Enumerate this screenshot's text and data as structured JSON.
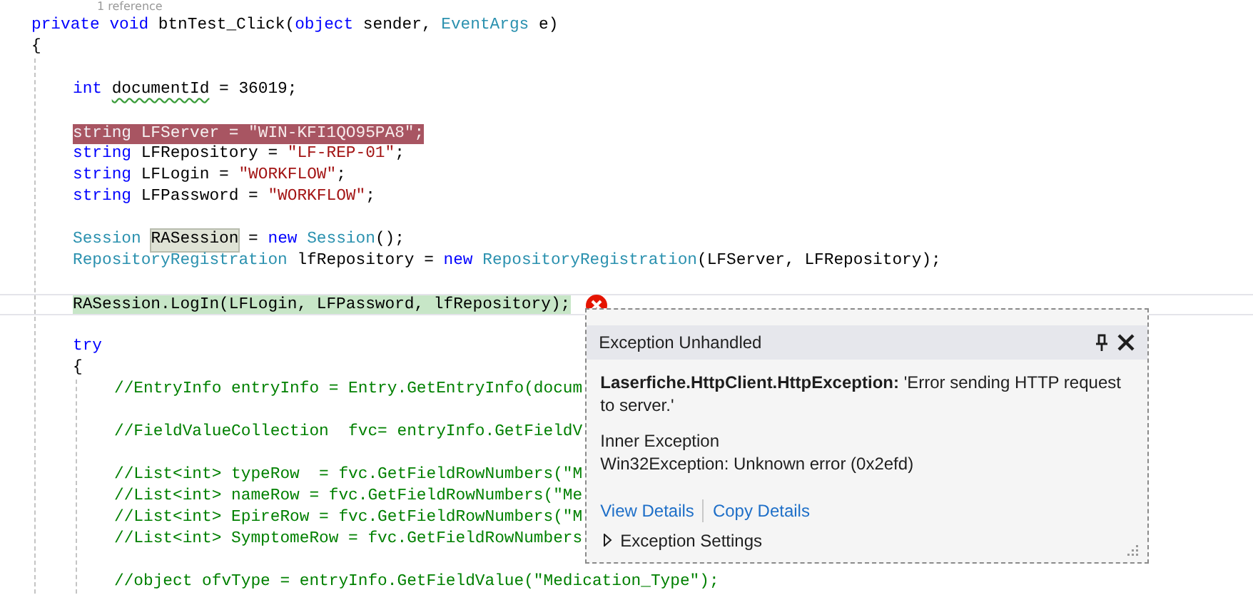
{
  "codelens": "1 reference",
  "lines": [
    {
      "kind": "code",
      "tokens": [
        {
          "kind": "keyword",
          "text": "private "
        },
        {
          "kind": "keyword",
          "text": "void"
        },
        {
          "kind": "plain",
          "text": " btnTest_Click("
        },
        {
          "kind": "keyword",
          "text": "object"
        },
        {
          "kind": "plain",
          "text": " sender, "
        },
        {
          "kind": "type",
          "text": "EventArgs"
        },
        {
          "kind": "plain",
          "text": " e)"
        }
      ]
    },
    {
      "kind": "code",
      "tokens": [
        {
          "kind": "plain",
          "text": "{"
        }
      ]
    },
    {
      "kind": "block",
      "children": [
        {
          "kind": "blank"
        },
        {
          "kind": "code",
          "tokens": [
            {
              "kind": "keyword",
              "text": "int "
            },
            {
              "kind": "plain",
              "text": "documentId",
              "squiggle": true
            },
            {
              "kind": "plain",
              "text": " = 36019;"
            }
          ]
        },
        {
          "kind": "blank"
        },
        {
          "kind": "code",
          "breakpoint": true,
          "tokens": [
            {
              "kind": "keyword",
              "text": "string"
            },
            {
              "kind": "plain",
              "text": " LFServer = "
            },
            {
              "kind": "string",
              "text": "\"WIN-KFI1QO95PA8\""
            },
            {
              "kind": "plain",
              "text": ";"
            }
          ]
        },
        {
          "kind": "code",
          "tokens": [
            {
              "kind": "keyword",
              "text": "string"
            },
            {
              "kind": "plain",
              "text": " LFRepository = "
            },
            {
              "kind": "string",
              "text": "\"LF-REP-01\""
            },
            {
              "kind": "plain",
              "text": ";"
            }
          ]
        },
        {
          "kind": "code",
          "tokens": [
            {
              "kind": "keyword",
              "text": "string"
            },
            {
              "kind": "plain",
              "text": " LFLogin = "
            },
            {
              "kind": "string",
              "text": "\"WORKFLOW\""
            },
            {
              "kind": "plain",
              "text": ";"
            }
          ]
        },
        {
          "kind": "code",
          "tokens": [
            {
              "kind": "keyword",
              "text": "string"
            },
            {
              "kind": "plain",
              "text": " LFPassword = "
            },
            {
              "kind": "string",
              "text": "\"WORKFLOW\""
            },
            {
              "kind": "plain",
              "text": ";"
            }
          ]
        },
        {
          "kind": "blank"
        },
        {
          "kind": "code",
          "tokens": [
            {
              "kind": "type",
              "text": "Session "
            },
            {
              "kind": "plain",
              "text": "RASession",
              "reference": true
            },
            {
              "kind": "plain",
              "text": " = "
            },
            {
              "kind": "keyword",
              "text": "new "
            },
            {
              "kind": "type",
              "text": "Session"
            },
            {
              "kind": "plain",
              "text": "();"
            }
          ]
        },
        {
          "kind": "code",
          "tokens": [
            {
              "kind": "type",
              "text": "RepositoryRegistration"
            },
            {
              "kind": "plain",
              "text": " lfRepository = "
            },
            {
              "kind": "keyword",
              "text": "new "
            },
            {
              "kind": "type",
              "text": "RepositoryRegistration"
            },
            {
              "kind": "plain",
              "text": "(LFServer, LFRepository);"
            }
          ]
        },
        {
          "kind": "blank"
        },
        {
          "kind": "code",
          "current": true,
          "error": true,
          "tokens": [
            {
              "kind": "plain",
              "text": "RASession.LogIn(LFLogin, LFPassword, lfRepository);"
            }
          ]
        },
        {
          "kind": "blank"
        },
        {
          "kind": "code",
          "tokens": [
            {
              "kind": "keyword",
              "text": "try"
            }
          ]
        },
        {
          "kind": "code",
          "tokens": [
            {
              "kind": "plain",
              "text": "{"
            }
          ]
        },
        {
          "kind": "block",
          "children": [
            {
              "kind": "code",
              "tokens": [
                {
                  "kind": "comment",
                  "text": "//EntryInfo entryInfo = Entry.GetEntryInfo(docum"
                }
              ]
            },
            {
              "kind": "blank"
            },
            {
              "kind": "code",
              "tokens": [
                {
                  "kind": "comment",
                  "text": "//FieldValueCollection  fvc= entryInfo.GetFieldV"
                }
              ]
            },
            {
              "kind": "blank"
            },
            {
              "kind": "code",
              "tokens": [
                {
                  "kind": "comment",
                  "text": "//List<int> typeRow  = fvc.GetFieldRowNumbers(\"M"
                }
              ]
            },
            {
              "kind": "code",
              "tokens": [
                {
                  "kind": "comment",
                  "text": "//List<int> nameRow = fvc.GetFieldRowNumbers(\"Me"
                }
              ]
            },
            {
              "kind": "code",
              "tokens": [
                {
                  "kind": "comment",
                  "text": "//List<int> EpireRow = fvc.GetFieldRowNumbers(\"M"
                }
              ]
            },
            {
              "kind": "code",
              "tokens": [
                {
                  "kind": "comment",
                  "text": "//List<int> SymptomeRow = fvc.GetFieldRowNumbers"
                }
              ]
            },
            {
              "kind": "blank"
            },
            {
              "kind": "code",
              "tokens": [
                {
                  "kind": "comment",
                  "text": "//object ofvType = entryInfo.GetFieldValue(\"Medication_Type\");"
                }
              ]
            }
          ]
        }
      ]
    }
  ],
  "exception_popup": {
    "title": "Exception Unhandled",
    "message": "**Laserfiche.HttpClient.HttpException:** 'Error sending HTTP request to server.'",
    "inner_label": "Inner Exception",
    "inner_message": "Win32Exception: Unknown error (0x2efd)",
    "links": [
      "View Details",
      "Copy Details"
    ],
    "settings": {
      "label": "Exception Settings",
      "expanded": false
    }
  }
}
